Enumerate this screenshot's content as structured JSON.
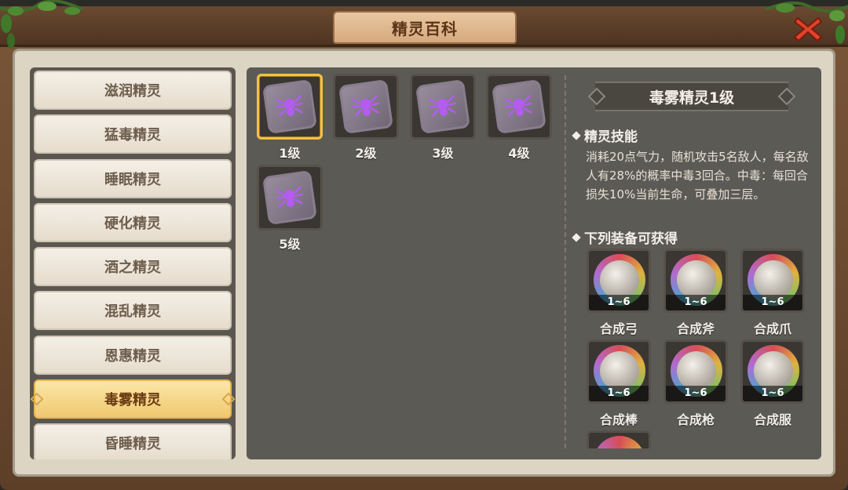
{
  "window": {
    "title": "精灵百科"
  },
  "sidebar": {
    "items": [
      {
        "label": "滋润精灵",
        "active": false
      },
      {
        "label": "猛毒精灵",
        "active": false
      },
      {
        "label": "睡眠精灵",
        "active": false
      },
      {
        "label": "硬化精灵",
        "active": false
      },
      {
        "label": "酒之精灵",
        "active": false
      },
      {
        "label": "混乱精灵",
        "active": false
      },
      {
        "label": "恩惠精灵",
        "active": false
      },
      {
        "label": "毒雾精灵",
        "active": true
      },
      {
        "label": "昏睡精灵",
        "active": false
      }
    ]
  },
  "levels": [
    {
      "label": "1级",
      "selected": true
    },
    {
      "label": "2级",
      "selected": false
    },
    {
      "label": "3级",
      "selected": false
    },
    {
      "label": "4级",
      "selected": false
    },
    {
      "label": "5级",
      "selected": false
    }
  ],
  "detail": {
    "title": "毒雾精灵1级",
    "skill_heading": "精灵技能",
    "skill_text": "消耗20点气力，随机攻击5名敌人，每名敌人有28%的概率中毒3回合。中毒：每回合损失10%当前生命，可叠加三层。",
    "equip_heading": "下列装备可获得",
    "equipment": [
      {
        "label": "合成弓",
        "range": "1~6",
        "icon": "bow-icon"
      },
      {
        "label": "合成斧",
        "range": "1~6",
        "icon": "axe-icon"
      },
      {
        "label": "合成爪",
        "range": "1~6",
        "icon": "claw-icon"
      },
      {
        "label": "合成棒",
        "range": "1~6",
        "icon": "club-icon"
      },
      {
        "label": "合成枪",
        "range": "1~6",
        "icon": "spear-icon"
      },
      {
        "label": "合成服",
        "range": "1~6",
        "icon": "armor-icon"
      }
    ]
  },
  "colors": {
    "active_tab": "#f0c96f",
    "selected_border": "#f2c14a",
    "gem_purple": "#b45cf0"
  }
}
